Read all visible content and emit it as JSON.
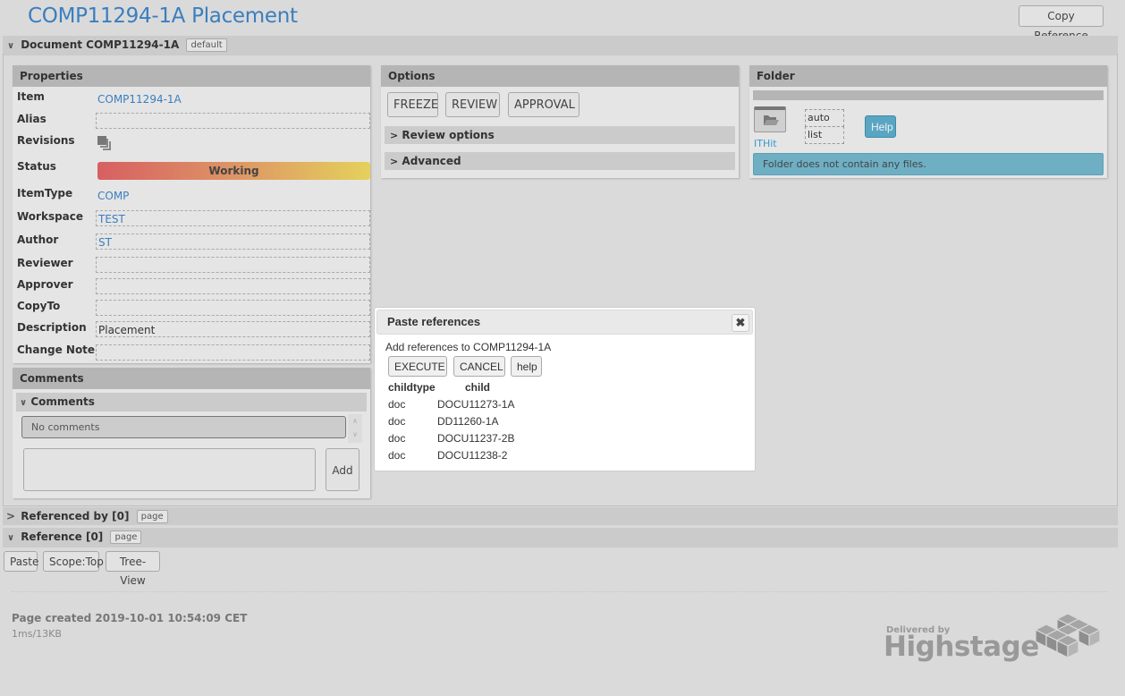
{
  "header": {
    "title": "COMP11294-1A Placement",
    "copy_reference_label": "Copy Reference"
  },
  "document_section": {
    "label": "Document COMP11294-1A",
    "tag": "default",
    "expanded": true
  },
  "properties": {
    "title": "Properties",
    "rows": {
      "item": {
        "label": "Item",
        "value": "COMP11294-1A"
      },
      "alias": {
        "label": "Alias",
        "value": ""
      },
      "revisions": {
        "label": "Revisions",
        "icon": "revisions-icon"
      },
      "status": {
        "label": "Status",
        "value": "Working"
      },
      "itemtype": {
        "label": "ItemType",
        "value": "COMP"
      },
      "workspace": {
        "label": "Workspace",
        "value": "TEST"
      },
      "author": {
        "label": "Author",
        "value": "ST"
      },
      "reviewer": {
        "label": "Reviewer",
        "value": ""
      },
      "approver": {
        "label": "Approver",
        "value": ""
      },
      "copyto": {
        "label": "CopyTo",
        "value": ""
      },
      "description": {
        "label": "Description",
        "value": "Placement"
      },
      "change_note": {
        "label": "Change Note",
        "value": ""
      }
    },
    "status_colors": {
      "start": "#d75f62",
      "end": "#e5d15c"
    }
  },
  "comments": {
    "title": "Comments",
    "sub_label": "Comments",
    "list_text": "No comments",
    "input_value": "",
    "add_label": "Add"
  },
  "options": {
    "title": "Options",
    "buttons": [
      "FREEZE",
      "REVIEW",
      "APPROVAL"
    ],
    "collapsibles": [
      "Review options",
      "Advanced"
    ]
  },
  "folder": {
    "title": "Folder",
    "folder_name": "ITHit",
    "mode_fields": [
      "auto",
      "list"
    ],
    "help_label": "Help",
    "message": "Folder does not contain any files.",
    "accent_color": "#6eafc4"
  },
  "referenced_by": {
    "label": "Referenced by [0]",
    "tag": "page",
    "expanded": false
  },
  "reference": {
    "label": "Reference [0]",
    "tag": "page",
    "expanded": true,
    "buttons": [
      "Paste",
      "Scope:Top",
      "Tree-View"
    ]
  },
  "footer": {
    "page_created": "Page created 2019-10-01 10:54:09 CET",
    "timing": "1ms/13KB",
    "logo_small": "Delivered by",
    "logo_big": "Highstage"
  },
  "dialog": {
    "title": "Paste references",
    "message": "Add references to COMP11294-1A",
    "buttons": [
      "EXECUTE",
      "CANCEL",
      "help"
    ],
    "columns": [
      "childtype",
      "child"
    ],
    "rows": [
      {
        "childtype": "doc",
        "child": "DOCU11273-1A"
      },
      {
        "childtype": "doc",
        "child": "DD11260-1A"
      },
      {
        "childtype": "doc",
        "child": "DOCU11237-2B"
      },
      {
        "childtype": "doc",
        "child": "DOCU11238-2"
      }
    ]
  }
}
